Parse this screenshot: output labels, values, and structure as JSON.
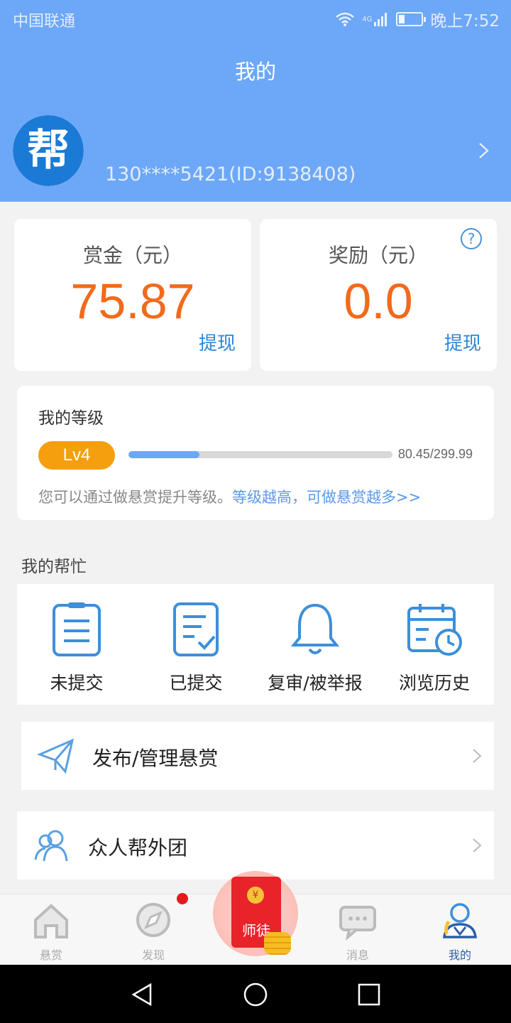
{
  "status_bar": {
    "carrier": "中国联通",
    "network": "4G",
    "time": "晚上7:52"
  },
  "header": {
    "title": "我的",
    "avatar_text": "帮",
    "user_id": "130****5421(ID:9138408)"
  },
  "balances": [
    {
      "label": "赏金（元）",
      "amount": "75.87",
      "action": "提现"
    },
    {
      "label": "奖励（元）",
      "amount": "0.0",
      "action": "提现"
    }
  ],
  "level": {
    "title": "我的等级",
    "badge": "Lv4",
    "progress_text": "80.45/299.99",
    "progress_value": 80.45,
    "progress_max": 299.99,
    "desc_prefix": "您可以通过做悬赏提升等级。",
    "desc_link": "等级越高，可做悬赏越多>>"
  },
  "my_help": {
    "title": "我的帮忙",
    "items": [
      {
        "label": "未提交",
        "icon": "clipboard-icon"
      },
      {
        "label": "已提交",
        "icon": "checked-document-icon"
      },
      {
        "label": "复审/被举报",
        "icon": "bell-icon"
      },
      {
        "label": "浏览历史",
        "icon": "calendar-clock-icon"
      }
    ]
  },
  "rows": [
    {
      "label": "发布/管理悬赏",
      "icon": "paper-plane-icon"
    },
    {
      "label": "众人帮外团",
      "icon": "users-icon"
    }
  ],
  "tabbar": {
    "tabs": [
      {
        "label": "悬赏",
        "icon": "home-icon"
      },
      {
        "label": "发现",
        "icon": "compass-icon"
      },
      {
        "label": "师徒",
        "icon": "red-envelope-icon"
      },
      {
        "label": "消息",
        "icon": "chat-icon"
      },
      {
        "label": "我的",
        "icon": "profile-icon"
      }
    ],
    "active": "我的",
    "coin_symbol": "¥"
  },
  "colors": {
    "header_bg": "#6da7f7",
    "amount": "#f26a1b",
    "link": "#2b86d9",
    "level_badge": "#f59f0e",
    "red_dot": "#e41a1a"
  }
}
